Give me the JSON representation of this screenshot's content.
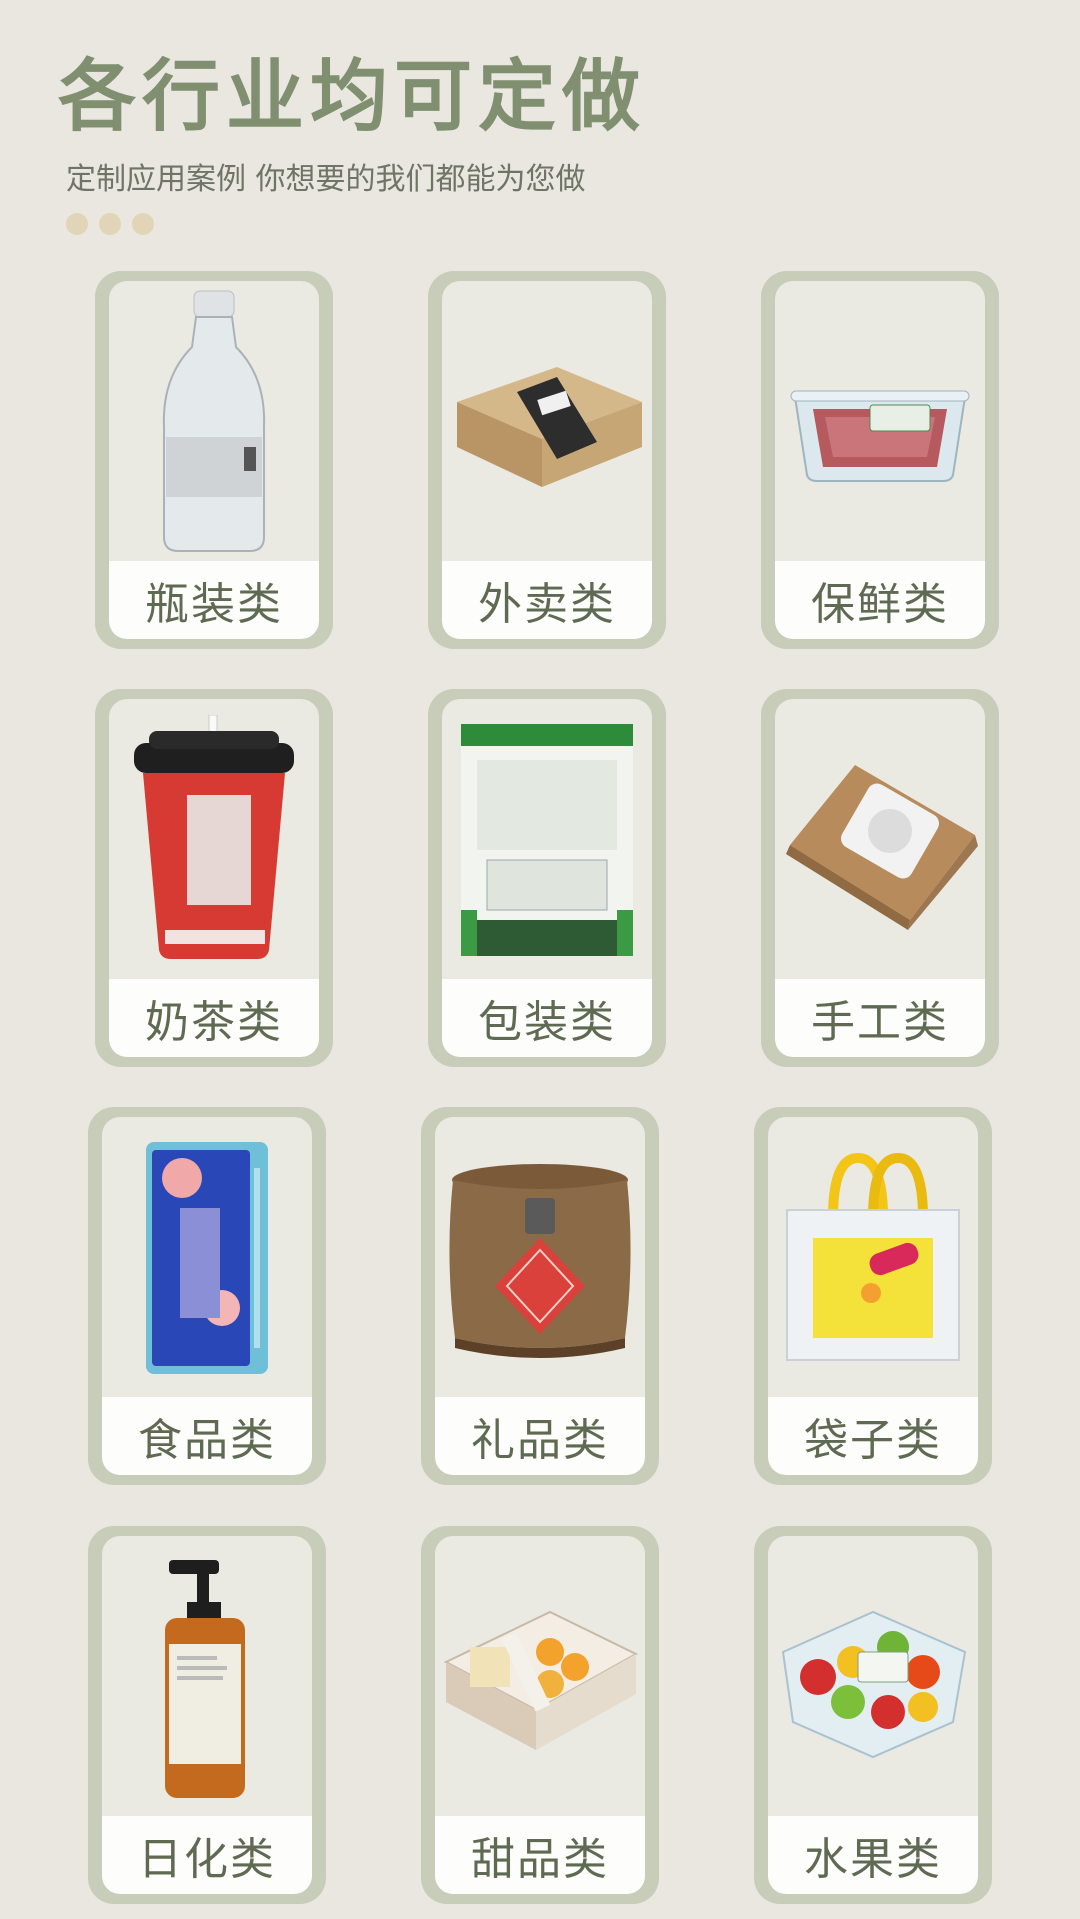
{
  "header": {
    "title": "各行业均可定做",
    "subtitle": "定制应用案例 你想要的我们都能为您做"
  },
  "categories": [
    {
      "label": "瓶装类",
      "icon": "water-bottle-icon"
    },
    {
      "label": "外卖类",
      "icon": "takeout-box-icon"
    },
    {
      "label": "保鲜类",
      "icon": "fresh-meat-container-icon"
    },
    {
      "label": "奶茶类",
      "icon": "milk-tea-cup-icon"
    },
    {
      "label": "包装类",
      "icon": "stand-up-pouch-icon"
    },
    {
      "label": "手工类",
      "icon": "kraft-box-icon"
    },
    {
      "label": "食品类",
      "icon": "food-package-icon"
    },
    {
      "label": "礼品类",
      "icon": "wooden-gift-barrel-icon"
    },
    {
      "label": "袋子类",
      "icon": "tote-bag-icon"
    },
    {
      "label": "日化类",
      "icon": "pump-bottle-icon"
    },
    {
      "label": "甜品类",
      "icon": "dessert-box-icon"
    },
    {
      "label": "水果类",
      "icon": "fruit-container-icon"
    }
  ],
  "colors": {
    "background": "#e9e7df",
    "title": "#7f8f70",
    "card_frame": "#c7cdb9",
    "label_text": "#5f6a52",
    "dots": "#e2d4b6"
  }
}
